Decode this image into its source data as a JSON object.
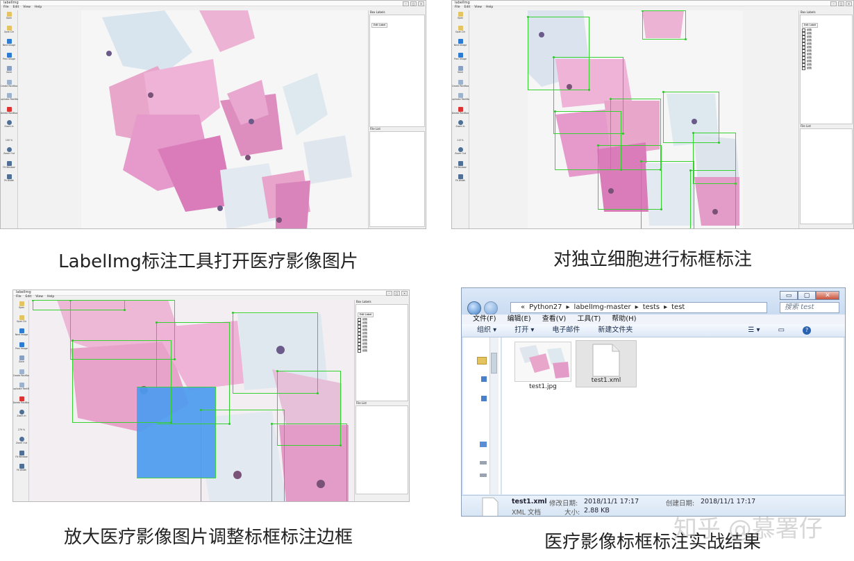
{
  "captions": {
    "top_left": "LabelImg标注工具打开医疗影像图片",
    "top_right": "对独立细胞进行标框标注",
    "bottom_left": "放大医疗影像图片调整标框标注边框",
    "bottom_right": "医疗影像标框标注实战结果"
  },
  "labelimg": {
    "title": "labelImg",
    "win_min": "–",
    "win_max": "□",
    "win_close": "×",
    "menu": [
      "File",
      "Edit",
      "View",
      "Help"
    ],
    "toolbar": [
      "Open",
      "Open Dir",
      "Next Image",
      "Prev Image",
      "Save",
      "Create RectBox",
      "Duplicate RectBox",
      "Delete RectBox",
      "Zoom In",
      "100 %",
      "Zoom Out",
      "Fit Window",
      "Fit Width"
    ],
    "toolbar_zoom_top_right": "2.8 %",
    "toolbar_zoom_bottom_left": "279 %",
    "box_labels_title": "Box Labels",
    "edit_label": "Edit Label",
    "file_list_title": "File List",
    "label_name": "细胞",
    "label_count_top_right": 12,
    "label_count_bottom_left": 10
  },
  "explorer": {
    "btn_min": "▭",
    "btn_max": "▢",
    "btn_close": "✕",
    "path": [
      "«",
      "Python27",
      "▸",
      "labelImg-master",
      "▸",
      "tests",
      "▸",
      "test"
    ],
    "search_placeholder": "搜索 test",
    "menu": [
      "文件(F)",
      "编辑(E)",
      "查看(V)",
      "工具(T)",
      "帮助(H)"
    ],
    "commands": [
      "组织 ▾",
      "打开 ▾",
      "电子邮件",
      "新建文件夹"
    ],
    "files": [
      {
        "name": "test1.jpg"
      },
      {
        "name": "test1.xml"
      }
    ],
    "status": {
      "filename": "test1.xml",
      "type": "XML 文档",
      "modified_label": "修改日期:",
      "modified": "2018/11/1 17:17",
      "created_label": "创建日期:",
      "created": "2018/11/1 17:17",
      "size_label": "大小:",
      "size": "2.88 KB"
    }
  },
  "watermark": "知乎 @慕署仔",
  "colors": {
    "bbox": "#35d12f",
    "selected_box": "#4d9cf0",
    "cell_pink": "#e7a3cc",
    "cell_blue": "#b9cde0"
  }
}
